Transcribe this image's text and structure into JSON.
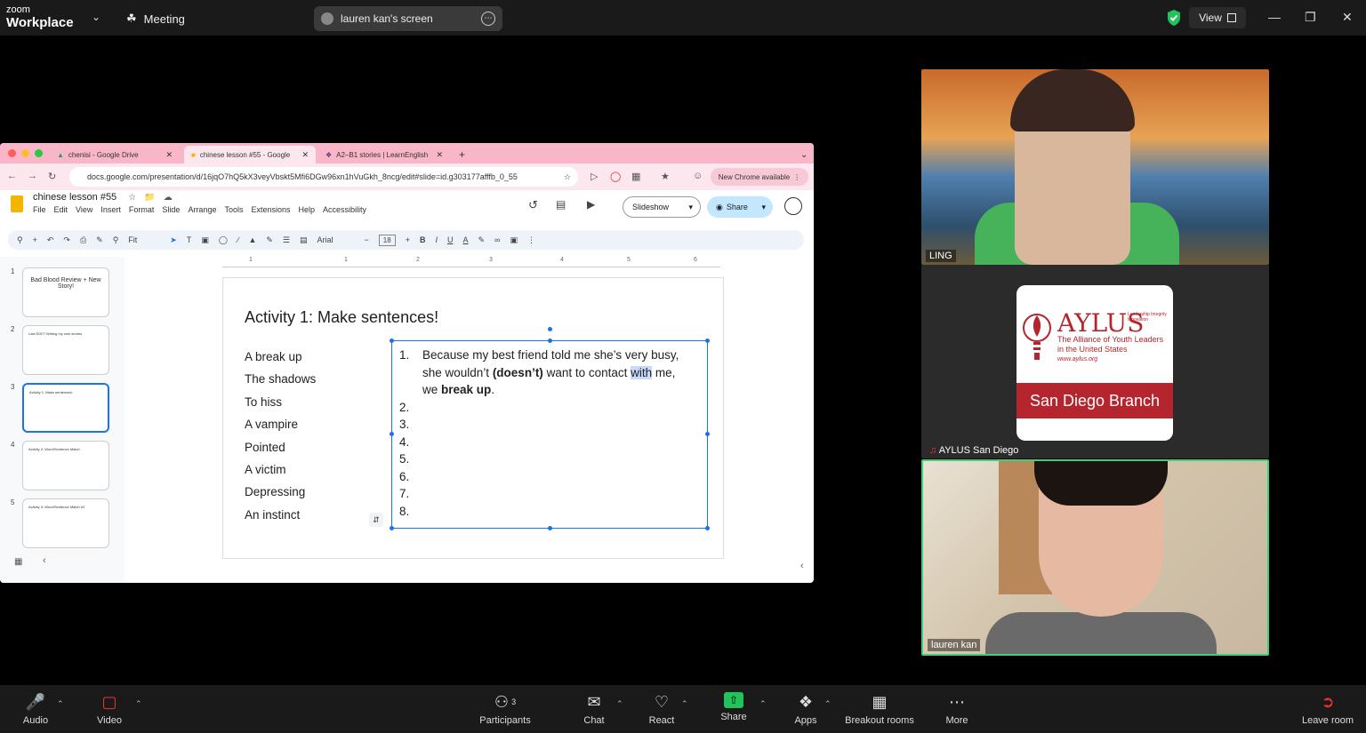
{
  "topbar": {
    "brand_small": "zoom",
    "brand_big": "Workplace",
    "meeting_label": "Meeting",
    "screen_label": "lauren kan's screen",
    "view_label": "View"
  },
  "browser": {
    "tabs": [
      {
        "label": "chenisi - Google Drive"
      },
      {
        "label": "chinese lesson #55 - Google"
      },
      {
        "label": "A2–B1 stories | LearnEnglish"
      }
    ],
    "url": "docs.google.com/presentation/d/16jqO7hQ5kX3veyVbskt5Mfi6DGw96xn1hVuGkh_8ncg/edit#slide=id.g303177afffb_0_55",
    "new_chrome": "New Chrome available"
  },
  "slides_app": {
    "doc_title": "chinese lesson #55",
    "menus": [
      "File",
      "Edit",
      "View",
      "Insert",
      "Format",
      "Slide",
      "Arrange",
      "Tools",
      "Extensions",
      "Help",
      "Accessibility"
    ],
    "slideshow_label": "Slideshow",
    "share_label": "Share",
    "toolbar": {
      "zoom": "Fit",
      "font": "Arial",
      "font_size": "18"
    },
    "ruler": [
      "1",
      "1",
      "2",
      "3",
      "4",
      "5",
      "6"
    ],
    "thumbnails": [
      {
        "num": "1",
        "text": "Bad Blood Review + New Story!"
      },
      {
        "num": "2",
        "text": "Last EDIT! Writing my own stories"
      },
      {
        "num": "3",
        "text": "Activity 1: Make sentences!"
      },
      {
        "num": "4",
        "text": "Activity 2: Word/Sentence Match"
      },
      {
        "num": "5",
        "text": "Activity 3: Word/Sentence Match #2"
      }
    ],
    "slide": {
      "title": "Activity 1: Make sentences!",
      "words": [
        "A break up",
        "The shadows",
        "To hiss",
        "A vampire",
        "Pointed",
        "A victim",
        "Depressing",
        "An instinct"
      ],
      "item1": {
        "num": "1.",
        "line1": "Because my best friend told me she’s very busy,",
        "line2a": "she wouldn’t ",
        "line2b": "(doesn’t)",
        "line2c": " want to contact ",
        "line2d": "with",
        "line2e": " me,",
        "line3a": "we ",
        "line3b": "break up",
        "line3c": "."
      },
      "numbers": [
        "2.",
        "3.",
        "4.",
        "5.",
        "6.",
        "7.",
        "8."
      ]
    }
  },
  "participants": {
    "ling": "LING",
    "aylus": "AYLUS San Diego",
    "lauren": "lauren kan"
  },
  "aylus_logo": {
    "name": "AYLUS",
    "lii": "Leadership Integrity Innovation",
    "sub1": "The Alliance of Youth Leaders",
    "sub2": "in the United States",
    "site": "www.aylus.org",
    "branch": "San Diego Branch"
  },
  "bottombar": {
    "audio": "Audio",
    "video": "Video",
    "participants": "Participants",
    "participants_count": "3",
    "chat": "Chat",
    "react": "React",
    "share": "Share",
    "apps": "Apps",
    "breakout": "Breakout rooms",
    "more": "More",
    "leave": "Leave room"
  },
  "colors": {
    "accent_blue": "#1a73e8",
    "zoom_green": "#21c45a",
    "aylus_red": "#b5252d",
    "tab_pink": "#f9b6c8"
  }
}
